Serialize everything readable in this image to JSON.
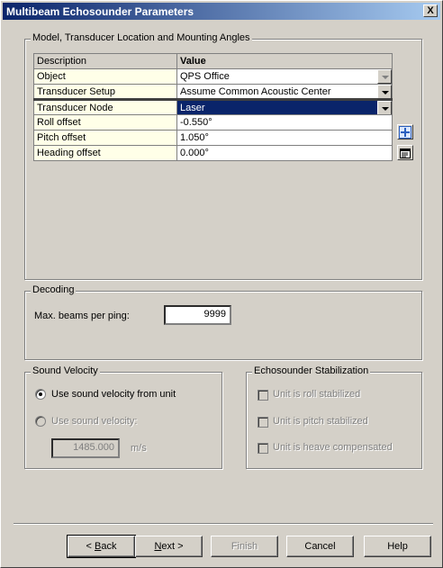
{
  "window": {
    "title": "Multibeam Echosounder Parameters",
    "close_label": "X"
  },
  "model_group": {
    "legend": "Model, Transducer Location and Mounting Angles",
    "columns": [
      "Description",
      "Value"
    ],
    "rows": [
      {
        "desc": "Object",
        "value": "QPS Office"
      },
      {
        "desc": "Transducer Setup",
        "value": "Assume Common Acoustic Center"
      },
      {
        "desc": "Transducer Node",
        "value": "Laser"
      },
      {
        "desc": "Roll offset",
        "value": "-0.550°"
      },
      {
        "desc": "Pitch offset",
        "value": "1.050°"
      },
      {
        "desc": "Heading offset",
        "value": "0.000°"
      }
    ]
  },
  "decoding": {
    "legend": "Decoding",
    "max_beams_label": "Max.  beams per ping:",
    "max_beams_value": "9999"
  },
  "sound_velocity": {
    "legend": "Sound Velocity",
    "option_unit": "Use sound velocity from unit",
    "option_custom": "Use sound velocity:",
    "custom_value": "1485.000",
    "unit": "m/s"
  },
  "stabilization": {
    "legend": "Echosounder Stabilization",
    "roll": "Unit is roll stabilized",
    "pitch": "Unit is pitch stabilized",
    "heave": "Unit is heave compensated"
  },
  "buttons": {
    "back_pre": "< ",
    "back_u": "B",
    "back_post": "ack",
    "next_pre": "",
    "next_u": "N",
    "next_post": "ext >",
    "finish": "Finish",
    "cancel": "Cancel",
    "help": "Help"
  },
  "colors": {
    "title_start": "#0a246a",
    "title_end": "#a6caf0",
    "face": "#d4d0c8",
    "selection": "#0a246a"
  }
}
